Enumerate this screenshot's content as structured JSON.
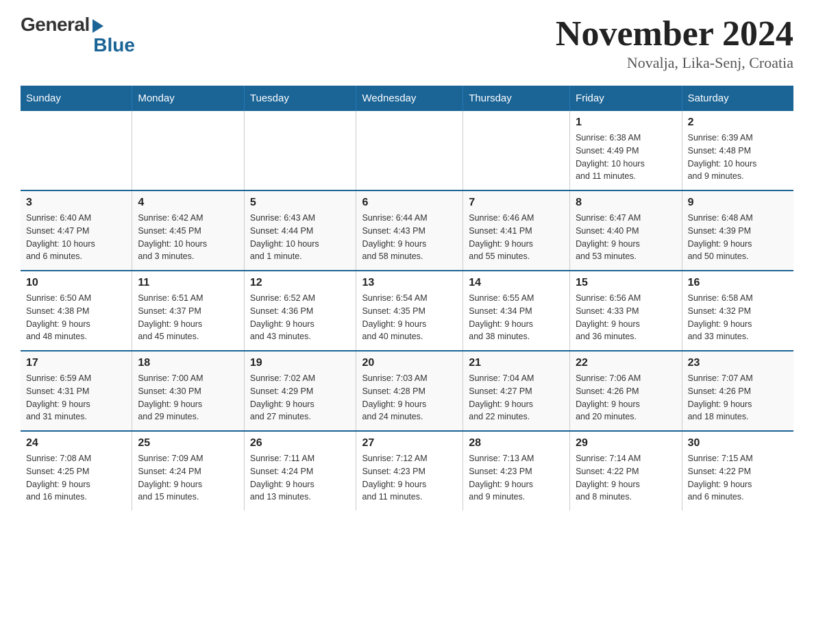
{
  "logo": {
    "general": "General",
    "blue": "Blue"
  },
  "title": "November 2024",
  "subtitle": "Novalja, Lika-Senj, Croatia",
  "weekdays": [
    "Sunday",
    "Monday",
    "Tuesday",
    "Wednesday",
    "Thursday",
    "Friday",
    "Saturday"
  ],
  "rows": [
    [
      {
        "day": "",
        "info": ""
      },
      {
        "day": "",
        "info": ""
      },
      {
        "day": "",
        "info": ""
      },
      {
        "day": "",
        "info": ""
      },
      {
        "day": "",
        "info": ""
      },
      {
        "day": "1",
        "info": "Sunrise: 6:38 AM\nSunset: 4:49 PM\nDaylight: 10 hours\nand 11 minutes."
      },
      {
        "day": "2",
        "info": "Sunrise: 6:39 AM\nSunset: 4:48 PM\nDaylight: 10 hours\nand 9 minutes."
      }
    ],
    [
      {
        "day": "3",
        "info": "Sunrise: 6:40 AM\nSunset: 4:47 PM\nDaylight: 10 hours\nand 6 minutes."
      },
      {
        "day": "4",
        "info": "Sunrise: 6:42 AM\nSunset: 4:45 PM\nDaylight: 10 hours\nand 3 minutes."
      },
      {
        "day": "5",
        "info": "Sunrise: 6:43 AM\nSunset: 4:44 PM\nDaylight: 10 hours\nand 1 minute."
      },
      {
        "day": "6",
        "info": "Sunrise: 6:44 AM\nSunset: 4:43 PM\nDaylight: 9 hours\nand 58 minutes."
      },
      {
        "day": "7",
        "info": "Sunrise: 6:46 AM\nSunset: 4:41 PM\nDaylight: 9 hours\nand 55 minutes."
      },
      {
        "day": "8",
        "info": "Sunrise: 6:47 AM\nSunset: 4:40 PM\nDaylight: 9 hours\nand 53 minutes."
      },
      {
        "day": "9",
        "info": "Sunrise: 6:48 AM\nSunset: 4:39 PM\nDaylight: 9 hours\nand 50 minutes."
      }
    ],
    [
      {
        "day": "10",
        "info": "Sunrise: 6:50 AM\nSunset: 4:38 PM\nDaylight: 9 hours\nand 48 minutes."
      },
      {
        "day": "11",
        "info": "Sunrise: 6:51 AM\nSunset: 4:37 PM\nDaylight: 9 hours\nand 45 minutes."
      },
      {
        "day": "12",
        "info": "Sunrise: 6:52 AM\nSunset: 4:36 PM\nDaylight: 9 hours\nand 43 minutes."
      },
      {
        "day": "13",
        "info": "Sunrise: 6:54 AM\nSunset: 4:35 PM\nDaylight: 9 hours\nand 40 minutes."
      },
      {
        "day": "14",
        "info": "Sunrise: 6:55 AM\nSunset: 4:34 PM\nDaylight: 9 hours\nand 38 minutes."
      },
      {
        "day": "15",
        "info": "Sunrise: 6:56 AM\nSunset: 4:33 PM\nDaylight: 9 hours\nand 36 minutes."
      },
      {
        "day": "16",
        "info": "Sunrise: 6:58 AM\nSunset: 4:32 PM\nDaylight: 9 hours\nand 33 minutes."
      }
    ],
    [
      {
        "day": "17",
        "info": "Sunrise: 6:59 AM\nSunset: 4:31 PM\nDaylight: 9 hours\nand 31 minutes."
      },
      {
        "day": "18",
        "info": "Sunrise: 7:00 AM\nSunset: 4:30 PM\nDaylight: 9 hours\nand 29 minutes."
      },
      {
        "day": "19",
        "info": "Sunrise: 7:02 AM\nSunset: 4:29 PM\nDaylight: 9 hours\nand 27 minutes."
      },
      {
        "day": "20",
        "info": "Sunrise: 7:03 AM\nSunset: 4:28 PM\nDaylight: 9 hours\nand 24 minutes."
      },
      {
        "day": "21",
        "info": "Sunrise: 7:04 AM\nSunset: 4:27 PM\nDaylight: 9 hours\nand 22 minutes."
      },
      {
        "day": "22",
        "info": "Sunrise: 7:06 AM\nSunset: 4:26 PM\nDaylight: 9 hours\nand 20 minutes."
      },
      {
        "day": "23",
        "info": "Sunrise: 7:07 AM\nSunset: 4:26 PM\nDaylight: 9 hours\nand 18 minutes."
      }
    ],
    [
      {
        "day": "24",
        "info": "Sunrise: 7:08 AM\nSunset: 4:25 PM\nDaylight: 9 hours\nand 16 minutes."
      },
      {
        "day": "25",
        "info": "Sunrise: 7:09 AM\nSunset: 4:24 PM\nDaylight: 9 hours\nand 15 minutes."
      },
      {
        "day": "26",
        "info": "Sunrise: 7:11 AM\nSunset: 4:24 PM\nDaylight: 9 hours\nand 13 minutes."
      },
      {
        "day": "27",
        "info": "Sunrise: 7:12 AM\nSunset: 4:23 PM\nDaylight: 9 hours\nand 11 minutes."
      },
      {
        "day": "28",
        "info": "Sunrise: 7:13 AM\nSunset: 4:23 PM\nDaylight: 9 hours\nand 9 minutes."
      },
      {
        "day": "29",
        "info": "Sunrise: 7:14 AM\nSunset: 4:22 PM\nDaylight: 9 hours\nand 8 minutes."
      },
      {
        "day": "30",
        "info": "Sunrise: 7:15 AM\nSunset: 4:22 PM\nDaylight: 9 hours\nand 6 minutes."
      }
    ]
  ]
}
